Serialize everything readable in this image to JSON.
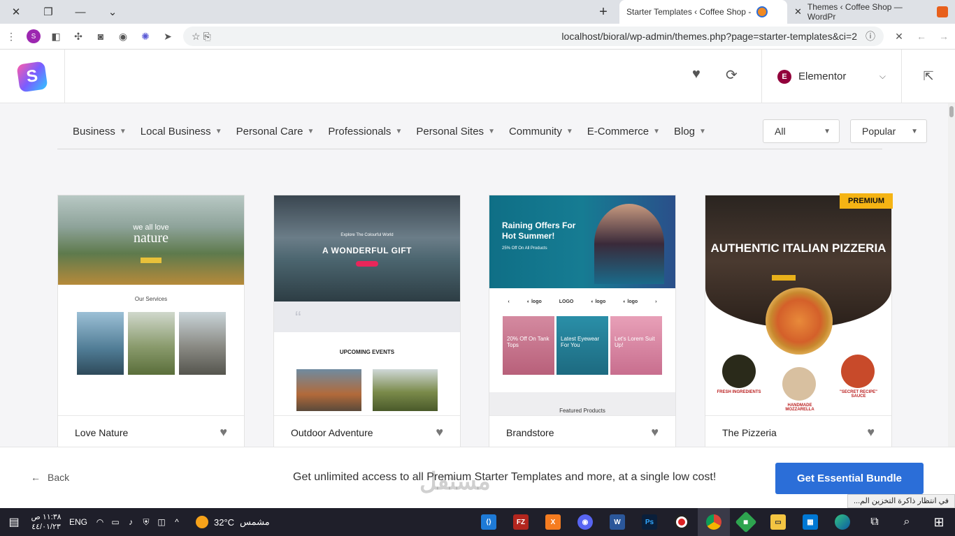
{
  "browser": {
    "tabs": [
      {
        "title": "Starter Templates ‹ Coffee Shop -",
        "active": true
      },
      {
        "title": "Themes ‹ Coffee Shop — WordPr",
        "active": false
      }
    ],
    "url": "localhost/bioral/wp-admin/themes.php?page=starter-templates&ci=2"
  },
  "header": {
    "logo_letter": "S",
    "builder_badge": "E",
    "builder_label": "Elementor"
  },
  "categories": [
    "Business",
    "Local Business",
    "Personal Care",
    "Professionals",
    "Personal Sites",
    "Community",
    "E-Commerce",
    "Blog"
  ],
  "filter_type": "All",
  "sort": "Popular",
  "cards": [
    {
      "name": "Love Nature",
      "hero_small": "we all love",
      "hero_big": "nature",
      "section": "Our Services",
      "premium": false
    },
    {
      "name": "Outdoor Adventure",
      "hero_small": "Explore The Colourful World",
      "hero_big": "A WONDERFUL GIFT",
      "section": "UPCOMING EVENTS",
      "premium": false
    },
    {
      "name": "Brandstore",
      "hero_small": "25% Off On All Products",
      "hero_big": "Raining Offers For Hot Summer!",
      "section": "Featured Products",
      "premium": false,
      "tiles": [
        "20% Off On Tank Tops",
        "Latest Eyewear For You",
        "Let's Lorem Suit Up!"
      ]
    },
    {
      "name": "The Pizzeria",
      "hero_small": "",
      "hero_big": "AUTHENTIC ITALIAN PIZZERIA",
      "section": "",
      "premium": true,
      "badge": "PREMIUM",
      "labels": [
        "FRESH INGREDIENTS",
        "HANDMADE MOZZARELLA",
        "\"SECRET RECIPE\" SAUCE"
      ]
    }
  ],
  "footer": {
    "back_label": "Back",
    "promo": "Get unlimited access to all Premium Starter Templates and more, at a single low cost!",
    "cta": "Get Essential Bundle"
  },
  "toast": "في انتظار ذاكرة التخزين الم...",
  "taskbar": {
    "time": "١١:٣٨ ص",
    "date": "٤٤/٠١/٢٣",
    "lang": "ENG",
    "weather_temp": "32°C",
    "weather_desc": "مشمس"
  },
  "watermark": "مستقل",
  "watermark_sub": "mostaql.com",
  "colors": {
    "accent": "#2b6ed8",
    "premium": "#f5b414",
    "elementor": "#92003b"
  }
}
